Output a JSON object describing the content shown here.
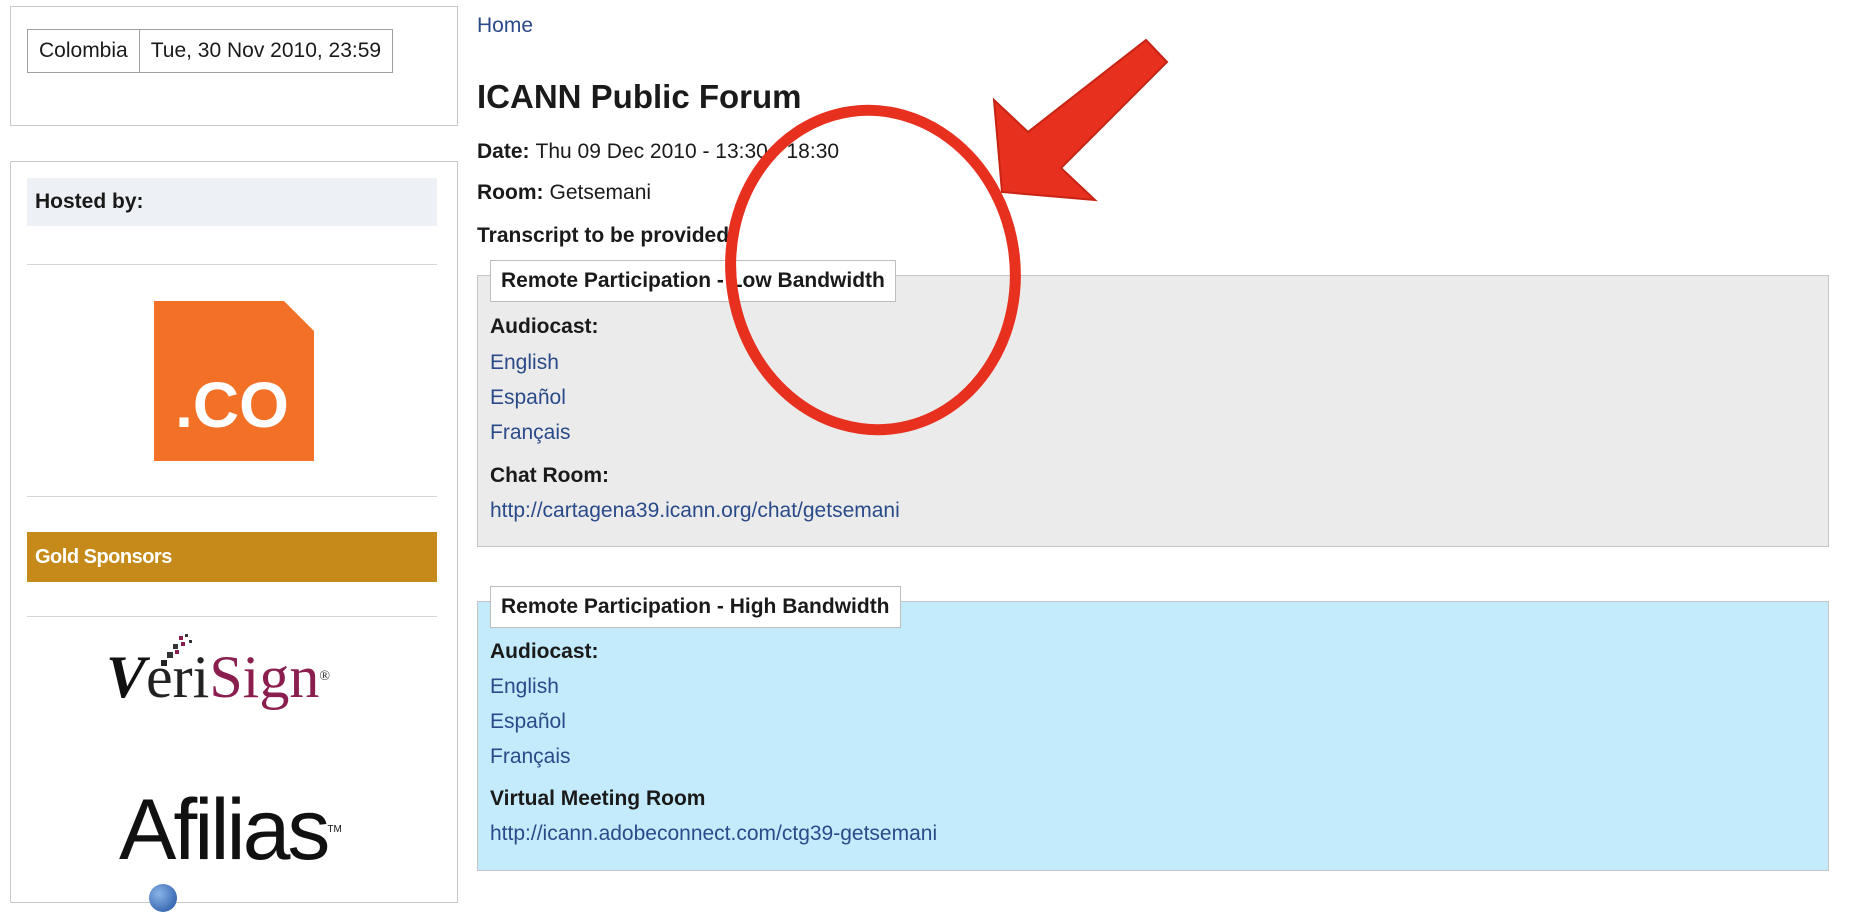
{
  "sidebar": {
    "clock": {
      "country": "Colombia",
      "datetime": "Tue, 30 Nov 2010, 23:59"
    },
    "hosted_by": "Hosted by:",
    "host_logo_text": ".CO",
    "gold_sponsors": "Gold Sponsors",
    "sponsors": [
      {
        "v": "V",
        "eri": "eri",
        "sign": "Sign",
        "tm": "®"
      },
      {
        "name": "Afilias",
        "tm": "TM"
      }
    ]
  },
  "breadcrumb": "Home",
  "page_title": "ICANN Public Forum",
  "meta": {
    "date_label": "Date:",
    "date_value": "Thu 09 Dec 2010 - 13:30 - 18:30",
    "room_label": "Room:",
    "room_value": "Getsemani",
    "transcript": "Transcript to be provided"
  },
  "low_bandwidth": {
    "legend": "Remote Participation - Low Bandwidth",
    "audiocast_label": "Audiocast:",
    "links": [
      "English",
      "Español",
      "Français"
    ],
    "chat_label": "Chat Room:",
    "chat_url": "http://cartagena39.icann.org/chat/getsemani"
  },
  "high_bandwidth": {
    "legend": "Remote Participation - High Bandwidth",
    "audiocast_label": "Audiocast:",
    "links": [
      "English",
      "Español",
      "Français"
    ],
    "vmr_label": "Virtual Meeting Room",
    "vmr_url": "http://icann.adobeconnect.com/ctg39-getsemani"
  },
  "colors": {
    "link": "#2a4a8a",
    "gold": "#c58a19",
    "low_bg": "#ebebeb",
    "high_bg": "#c4ebfb",
    "annotation": "#e8301f",
    "co_orange": "#f27127"
  },
  "annotation": {
    "shape": "ellipse-and-arrow",
    "color": "#e8301f"
  }
}
